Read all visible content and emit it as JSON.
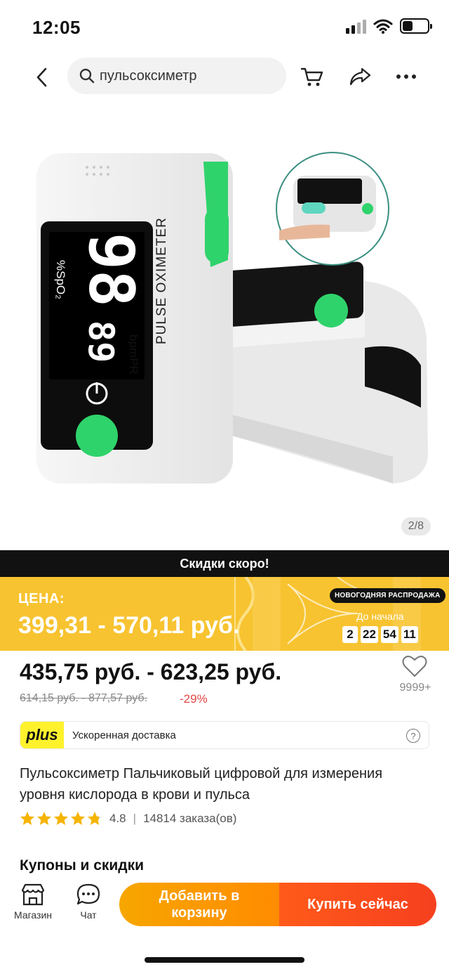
{
  "status_bar": {
    "time": "12:05"
  },
  "search": {
    "query": "пульсоксиметр"
  },
  "gallery": {
    "counter": "2/8",
    "device": {
      "big_number": "98",
      "small_number": "89",
      "spo2_label": "%SpO₂",
      "bpm_label": "bpmPR",
      "side_text": "PULSE OXIMETER"
    }
  },
  "promo": {
    "headline": "Скидки скоро!",
    "price_label": "ЦЕНА:",
    "price_range": "399,31 - 570,11 руб.",
    "sale_badge": "НОВОГОДНЯЯ РАСПРОДАЖА",
    "start_label": "До начала",
    "timer": {
      "days": "2",
      "hours": "22",
      "minutes": "54",
      "seconds": "11"
    }
  },
  "price": {
    "current": "435,75 руб. - 623,25 руб.",
    "old": "614,15 руб. - 877,57 руб.",
    "discount": "-29%",
    "wish_count": "9999+"
  },
  "delivery": {
    "badge": "plus",
    "text": "Ускоренная доставка",
    "help": "?"
  },
  "product": {
    "title": "Пульсоксиметр Пальчиковый цифровой для измерения уровня кислорода в крови и пульса",
    "rating": "4.8",
    "rating_value": 4.8,
    "orders": "14814 заказа(ов)"
  },
  "coupons_title": "Купоны и скидки",
  "bottom": {
    "store_label": "Магазин",
    "chat_label": "Чат",
    "add_to_cart": "Добавить в корзину",
    "buy_now": "Купить сейчас"
  },
  "colors": {
    "accent_orange": "#ff8c00",
    "buy_red": "#f6401f",
    "promo_yellow": "#f7c330",
    "device_green": "#2fd36b"
  }
}
